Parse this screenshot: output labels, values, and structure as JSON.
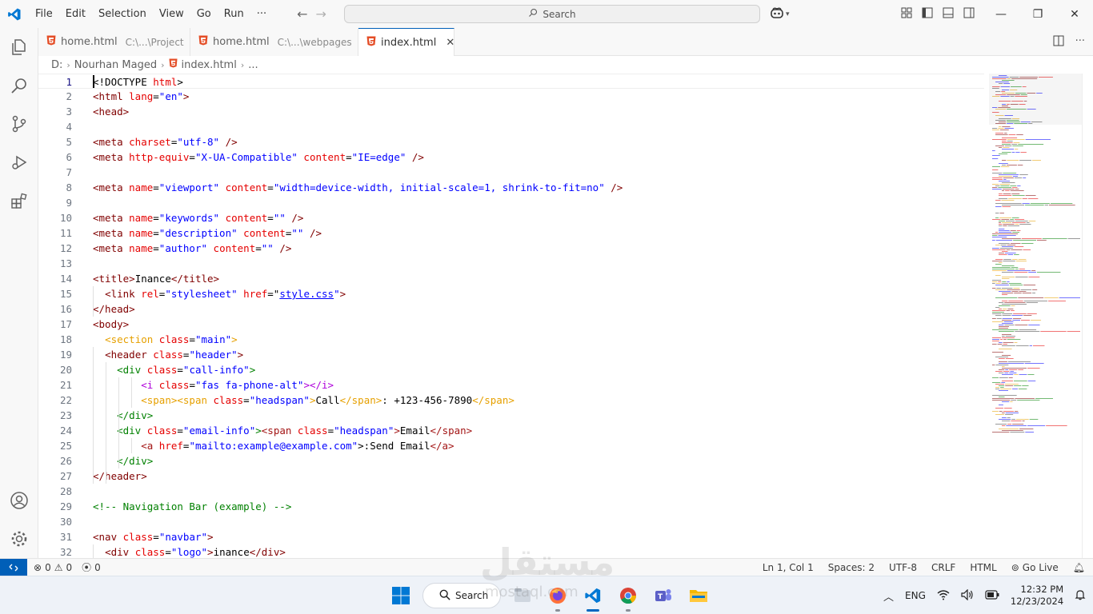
{
  "titlebar": {
    "menu": [
      "File",
      "Edit",
      "Selection",
      "View",
      "Go",
      "Run",
      "···"
    ],
    "search_label": "Search"
  },
  "tabs": [
    {
      "name": "home.html",
      "path": "C:\\...\\Project",
      "active": false
    },
    {
      "name": "home.html",
      "path": "C:\\...\\webpages",
      "active": false
    },
    {
      "name": "index.html",
      "path": "",
      "active": true
    }
  ],
  "breadcrumb": {
    "drive": "D:",
    "folder": "Nourhan Maged",
    "file": "index.html",
    "more": "..."
  },
  "editor": {
    "lines": [
      {
        "n": "1",
        "segs": [
          [
            "t-txt",
            "<!DOCTYPE "
          ],
          [
            "t-attr",
            "html"
          ],
          [
            "t-txt",
            ">"
          ]
        ]
      },
      {
        "n": "2",
        "segs": [
          [
            "t-tag",
            "<html "
          ],
          [
            "t-attr",
            "lang"
          ],
          [
            "t-txt",
            "="
          ],
          [
            "t-str",
            "\"en\""
          ],
          [
            "t-tag",
            ">"
          ]
        ]
      },
      {
        "n": "3",
        "segs": [
          [
            "t-tag",
            "<head>"
          ]
        ]
      },
      {
        "n": "4",
        "segs": []
      },
      {
        "n": "5",
        "segs": [
          [
            "t-tag",
            "<meta "
          ],
          [
            "t-attr",
            "charset"
          ],
          [
            "t-txt",
            "="
          ],
          [
            "t-str",
            "\"utf-8\""
          ],
          [
            "t-tag",
            " />"
          ]
        ]
      },
      {
        "n": "6",
        "segs": [
          [
            "t-tag",
            "<meta "
          ],
          [
            "t-attr",
            "http-equiv"
          ],
          [
            "t-txt",
            "="
          ],
          [
            "t-str",
            "\"X-UA-Compatible\""
          ],
          [
            "t-txt",
            " "
          ],
          [
            "t-attr",
            "content"
          ],
          [
            "t-txt",
            "="
          ],
          [
            "t-str",
            "\"IE=edge\""
          ],
          [
            "t-tag",
            " />"
          ]
        ]
      },
      {
        "n": "7",
        "segs": []
      },
      {
        "n": "8",
        "segs": [
          [
            "t-tag",
            "<meta "
          ],
          [
            "t-attr",
            "name"
          ],
          [
            "t-txt",
            "="
          ],
          [
            "t-str",
            "\"viewport\""
          ],
          [
            "t-txt",
            " "
          ],
          [
            "t-attr",
            "content"
          ],
          [
            "t-txt",
            "="
          ],
          [
            "t-str",
            "\"width=device-width, initial-scale=1, shrink-to-fit=no\""
          ],
          [
            "t-tag",
            " />"
          ]
        ]
      },
      {
        "n": "9",
        "segs": []
      },
      {
        "n": "10",
        "segs": [
          [
            "t-tag",
            "<meta "
          ],
          [
            "t-attr",
            "name"
          ],
          [
            "t-txt",
            "="
          ],
          [
            "t-str",
            "\"keywords\""
          ],
          [
            "t-txt",
            " "
          ],
          [
            "t-attr",
            "content"
          ],
          [
            "t-txt",
            "="
          ],
          [
            "t-str",
            "\"\""
          ],
          [
            "t-tag",
            " />"
          ]
        ]
      },
      {
        "n": "11",
        "segs": [
          [
            "t-tag",
            "<meta "
          ],
          [
            "t-attr",
            "name"
          ],
          [
            "t-txt",
            "="
          ],
          [
            "t-str",
            "\"description\""
          ],
          [
            "t-txt",
            " "
          ],
          [
            "t-attr",
            "content"
          ],
          [
            "t-txt",
            "="
          ],
          [
            "t-str",
            "\"\""
          ],
          [
            "t-tag",
            " />"
          ]
        ]
      },
      {
        "n": "12",
        "segs": [
          [
            "t-tag",
            "<meta "
          ],
          [
            "t-attr",
            "name"
          ],
          [
            "t-txt",
            "="
          ],
          [
            "t-str",
            "\"author\""
          ],
          [
            "t-txt",
            " "
          ],
          [
            "t-attr",
            "content"
          ],
          [
            "t-txt",
            "="
          ],
          [
            "t-str",
            "\"\""
          ],
          [
            "t-tag",
            " />"
          ]
        ]
      },
      {
        "n": "13",
        "segs": []
      },
      {
        "n": "14",
        "segs": [
          [
            "t-tag",
            "<title>"
          ],
          [
            "t-txt",
            "Inance"
          ],
          [
            "t-tag",
            "</title>"
          ]
        ]
      },
      {
        "n": "15",
        "segs": [
          [
            "t-txt",
            "  "
          ],
          [
            "t-tag",
            "<link "
          ],
          [
            "t-attr",
            "rel"
          ],
          [
            "t-txt",
            "="
          ],
          [
            "t-str",
            "\"stylesheet\""
          ],
          [
            "t-txt",
            " "
          ],
          [
            "t-attr",
            "href"
          ],
          [
            "t-txt",
            "=\""
          ],
          [
            "t-link",
            "style.css"
          ],
          [
            "t-str",
            "\""
          ],
          [
            "t-tag",
            ">"
          ]
        ]
      },
      {
        "n": "16",
        "segs": [
          [
            "t-tag",
            "</head>"
          ]
        ]
      },
      {
        "n": "17",
        "segs": [
          [
            "t-tag",
            "<body>"
          ]
        ]
      },
      {
        "n": "18",
        "segs": [
          [
            "t-txt",
            "  "
          ],
          [
            "t-tag2",
            "<section "
          ],
          [
            "t-attr",
            "class"
          ],
          [
            "t-txt",
            "="
          ],
          [
            "t-str",
            "\"main\""
          ],
          [
            "t-tag2",
            ">"
          ]
        ]
      },
      {
        "n": "19",
        "segs": [
          [
            "t-txt",
            "  "
          ],
          [
            "t-tag",
            "<header "
          ],
          [
            "t-attr",
            "class"
          ],
          [
            "t-txt",
            "="
          ],
          [
            "t-str",
            "\"header\""
          ],
          [
            "t-tag",
            ">"
          ]
        ]
      },
      {
        "n": "20",
        "segs": [
          [
            "t-txt",
            "    "
          ],
          [
            "t-tag3",
            "<div "
          ],
          [
            "t-attr",
            "class"
          ],
          [
            "t-txt",
            "="
          ],
          [
            "t-str",
            "\"call-info\""
          ],
          [
            "t-tag3",
            ">"
          ]
        ]
      },
      {
        "n": "21",
        "segs": [
          [
            "t-txt",
            "        "
          ],
          [
            "t-magenta",
            "<i "
          ],
          [
            "t-attr",
            "class"
          ],
          [
            "t-txt",
            "="
          ],
          [
            "t-str",
            "\"fas fa-phone-alt\""
          ],
          [
            "t-magenta",
            "></i>"
          ]
        ]
      },
      {
        "n": "22",
        "segs": [
          [
            "t-txt",
            "        "
          ],
          [
            "t-tag2",
            "<span>"
          ],
          [
            "t-tag2",
            "<span "
          ],
          [
            "t-attr",
            "class"
          ],
          [
            "t-txt",
            "="
          ],
          [
            "t-str",
            "\"headspan\""
          ],
          [
            "t-tag2",
            ">"
          ],
          [
            "t-txt",
            "Call"
          ],
          [
            "t-tag2",
            "</span>"
          ],
          [
            "t-txt",
            ": +123-456-7890"
          ],
          [
            "t-tag2",
            "</span>"
          ]
        ]
      },
      {
        "n": "23",
        "segs": [
          [
            "t-txt",
            "    "
          ],
          [
            "t-tag3",
            "</div>"
          ]
        ]
      },
      {
        "n": "24",
        "segs": [
          [
            "t-txt",
            "    "
          ],
          [
            "t-tag3",
            "<div "
          ],
          [
            "t-attr",
            "class"
          ],
          [
            "t-txt",
            "="
          ],
          [
            "t-str",
            "\"email-info\""
          ],
          [
            "t-tag3",
            ">"
          ],
          [
            "t-tag4",
            "<span "
          ],
          [
            "t-attr",
            "class"
          ],
          [
            "t-txt",
            "="
          ],
          [
            "t-str",
            "\"headspan\""
          ],
          [
            "t-tag4",
            ">"
          ],
          [
            "t-txt",
            "Email"
          ],
          [
            "t-tag4",
            "</span>"
          ]
        ]
      },
      {
        "n": "25",
        "segs": [
          [
            "t-txt",
            "        "
          ],
          [
            "t-tag4",
            "<a "
          ],
          [
            "t-attr",
            "href"
          ],
          [
            "t-txt",
            "="
          ],
          [
            "t-str",
            "\"mailto:example@example.com\""
          ],
          [
            "t-txt",
            ">:Send Email"
          ],
          [
            "t-tag4",
            "</a>"
          ]
        ]
      },
      {
        "n": "26",
        "segs": [
          [
            "t-txt",
            "    "
          ],
          [
            "t-tag3",
            "</div>"
          ]
        ]
      },
      {
        "n": "27",
        "segs": [
          [
            "t-tag",
            "</header>"
          ]
        ]
      },
      {
        "n": "28",
        "segs": []
      },
      {
        "n": "29",
        "segs": [
          [
            "t-com",
            "<!-- Navigation Bar (example) -->"
          ]
        ]
      },
      {
        "n": "30",
        "segs": []
      },
      {
        "n": "31",
        "segs": [
          [
            "t-tag",
            "<nav "
          ],
          [
            "t-attr",
            "class"
          ],
          [
            "t-txt",
            "="
          ],
          [
            "t-str",
            "\"navbar\""
          ],
          [
            "t-tag",
            ">"
          ]
        ]
      },
      {
        "n": "32",
        "segs": [
          [
            "t-txt",
            "  "
          ],
          [
            "t-tag",
            "<div "
          ],
          [
            "t-attr",
            "class"
          ],
          [
            "t-txt",
            "="
          ],
          [
            "t-str",
            "\"logo\""
          ],
          [
            "t-tag",
            ">"
          ],
          [
            "t-txt",
            "inance"
          ],
          [
            "t-tag",
            "</div>"
          ]
        ]
      }
    ]
  },
  "statusbar": {
    "errors": "0",
    "warnings": "0",
    "ports": "0",
    "position": "Ln 1, Col 1",
    "spaces": "Spaces: 2",
    "encoding": "UTF-8",
    "eol": "CRLF",
    "language": "HTML",
    "golive": "Go Live"
  },
  "taskbar": {
    "search_label": "Search",
    "lang": "ENG",
    "time": "12:32 PM",
    "date": "12/23/2024"
  },
  "watermark": {
    "arabic": "مستقل",
    "latin": "mostaql.com"
  }
}
